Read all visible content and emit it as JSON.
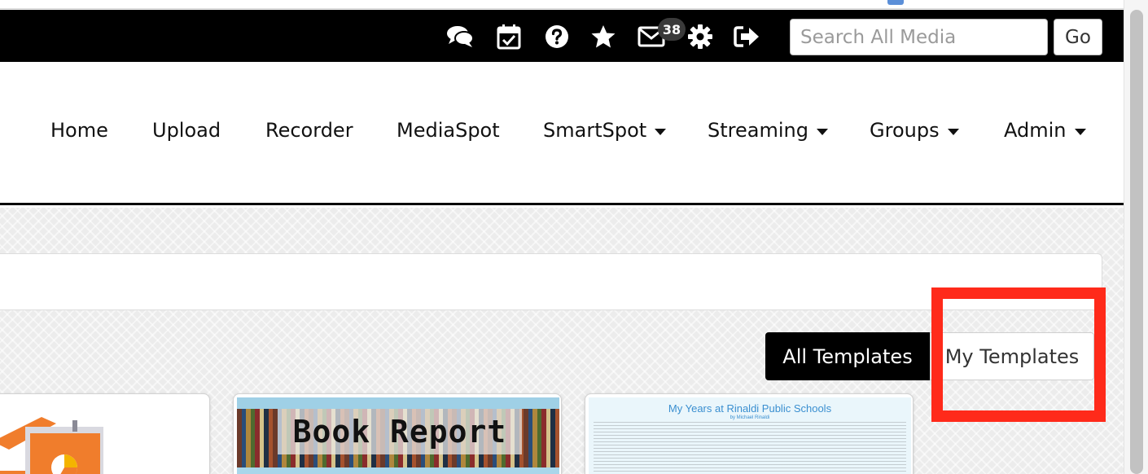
{
  "toolbar": {
    "icons": [
      "chat-icon",
      "calendar-check-icon",
      "help-icon",
      "star-icon",
      "mail-icon",
      "gear-icon",
      "sign-out-icon"
    ],
    "mail_badge": "38",
    "search_placeholder": "Search All Media",
    "go_label": "Go"
  },
  "nav": {
    "items": [
      {
        "label": "Home",
        "dropdown": false
      },
      {
        "label": "Upload",
        "dropdown": false
      },
      {
        "label": "Recorder",
        "dropdown": false
      },
      {
        "label": "MediaSpot",
        "dropdown": false
      },
      {
        "label": "SmartSpot",
        "dropdown": true
      },
      {
        "label": "Streaming",
        "dropdown": true
      },
      {
        "label": "Groups",
        "dropdown": true
      },
      {
        "label": "Admin",
        "dropdown": true
      }
    ]
  },
  "templates": {
    "all_label": "All Templates",
    "my_label": "My Templates",
    "active": "all",
    "highlight_color": "#ff2a1a"
  },
  "cards": [
    {
      "thumbnail": "presentation-chart-icon"
    },
    {
      "thumbnail_title": "Book Report"
    },
    {
      "thumbnail_title": "My Years at Rinaldi Public Schools",
      "thumbnail_subtitle": "by Michael Rinaldi"
    }
  ],
  "colors": {
    "toolbar_bg": "#000000",
    "nav_underline": "#000000",
    "active_button_bg": "#000000"
  }
}
